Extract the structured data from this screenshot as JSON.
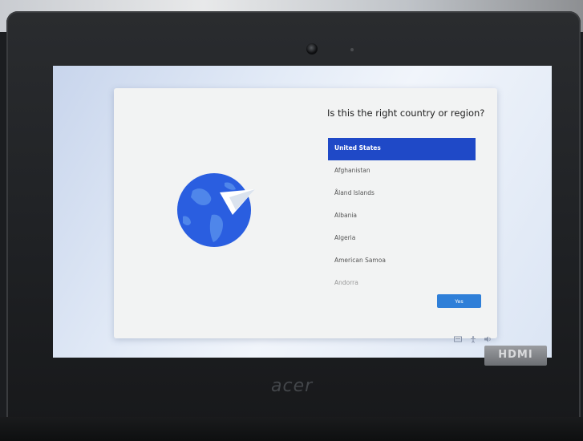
{
  "setup": {
    "question": "Is this the right country or region?",
    "countries": [
      "United States",
      "Afghanistan",
      "Åland Islands",
      "Albania",
      "Algeria",
      "American Samoa",
      "Andorra"
    ],
    "selected_index": 0,
    "yes_label": "Yes"
  },
  "device": {
    "brand": "acer",
    "port_label": "HDMI"
  },
  "taskbar": {
    "icons": [
      "keyboard-icon",
      "accessibility-icon",
      "volume-icon"
    ]
  },
  "colors": {
    "selected_bg": "#1f49c7",
    "button_bg": "#2f7fd8",
    "globe": "#2a5ee0"
  }
}
